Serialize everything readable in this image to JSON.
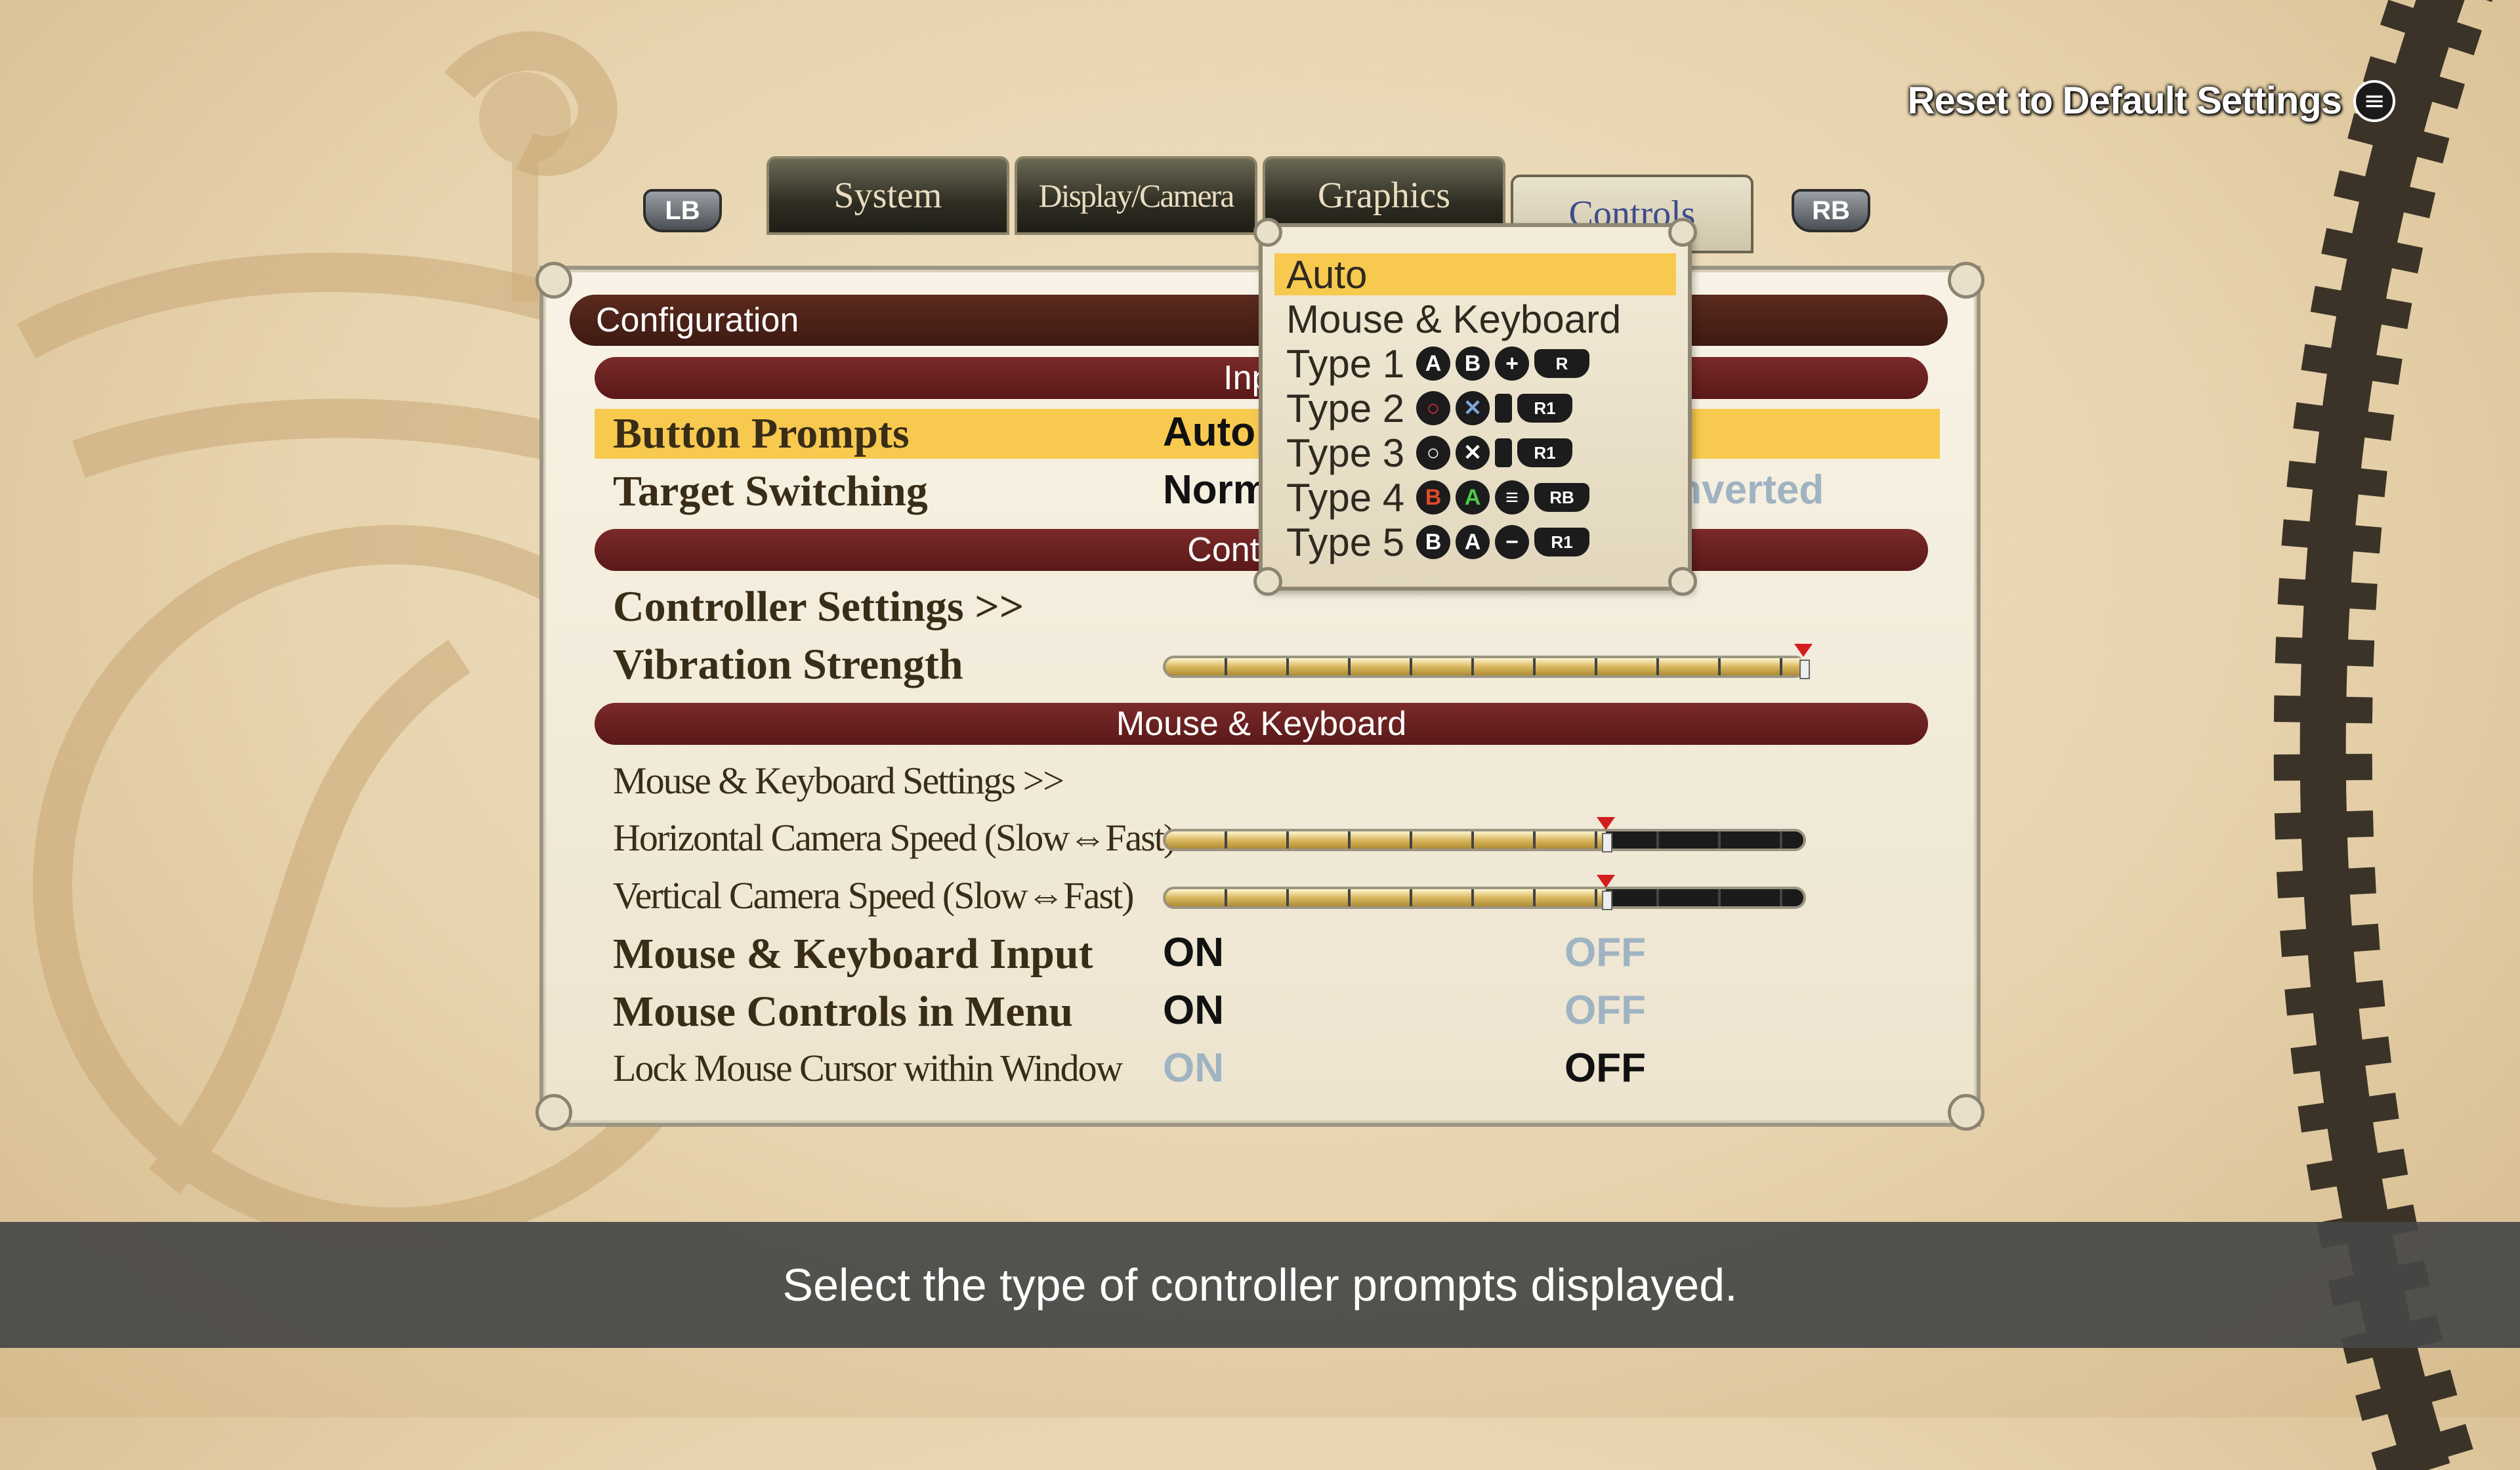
{
  "reset": {
    "label": "Reset to Default Settings",
    "icon": "menu-icon"
  },
  "tabs": {
    "lb": "LB",
    "rb": "RB",
    "items": [
      "System",
      "Display/Camera",
      "Graphics",
      "Controls"
    ]
  },
  "config": {
    "header": "Configuration"
  },
  "sections": {
    "input": "Input",
    "controller": "Controller",
    "mouse_keyboard": "Mouse & Keyboard"
  },
  "rows": {
    "button_prompts": {
      "label": "Button Prompts",
      "value": "Auto"
    },
    "target_switching": {
      "label": "Target Switching",
      "value": "Normal",
      "alt": "Inverted"
    },
    "controller_settings": {
      "label": "Controller Settings >>"
    },
    "vibration": {
      "label": "Vibration Strength",
      "level": 1.0
    },
    "mk_settings": {
      "label": "Mouse & Keyboard Settings >>"
    },
    "h_cam": {
      "label": "Horizontal Camera Speed (Slow⇔Fast)",
      "level": 0.69
    },
    "v_cam": {
      "label": "Vertical Camera Speed (Slow⇔Fast)",
      "level": 0.69
    },
    "mk_input": {
      "label": "Mouse & Keyboard Input",
      "on": "ON",
      "off": "OFF",
      "selected": "ON"
    },
    "mouse_menu": {
      "label": "Mouse Controls in Menu",
      "on": "ON",
      "off": "OFF",
      "selected": "ON"
    },
    "lock_cursor": {
      "label": "Lock Mouse Cursor within Window",
      "on": "ON",
      "off": "OFF",
      "selected": "OFF"
    }
  },
  "dropdown": {
    "options": [
      {
        "name": "Auto"
      },
      {
        "name": "Mouse & Keyboard"
      },
      {
        "name": "Type 1",
        "icons": [
          "A",
          "B",
          "+",
          "R"
        ]
      },
      {
        "name": "Type 2",
        "icons": [
          "circle",
          "cross",
          "OPTIONS",
          "R1"
        ]
      },
      {
        "name": "Type 3",
        "icons": [
          "circle",
          "cross",
          "stick",
          "R1"
        ]
      },
      {
        "name": "Type 4",
        "icons": [
          "B",
          "A",
          "menu",
          "RB"
        ]
      },
      {
        "name": "Type 5",
        "icons": [
          "B",
          "A",
          "minus",
          "R1"
        ]
      }
    ],
    "selected": "Auto"
  },
  "help": {
    "text": "Select the type of controller prompts displayed."
  },
  "colors": {
    "highlight": "#f7c94f",
    "section": "#6a1f1f",
    "off": "#9fb3c2"
  }
}
